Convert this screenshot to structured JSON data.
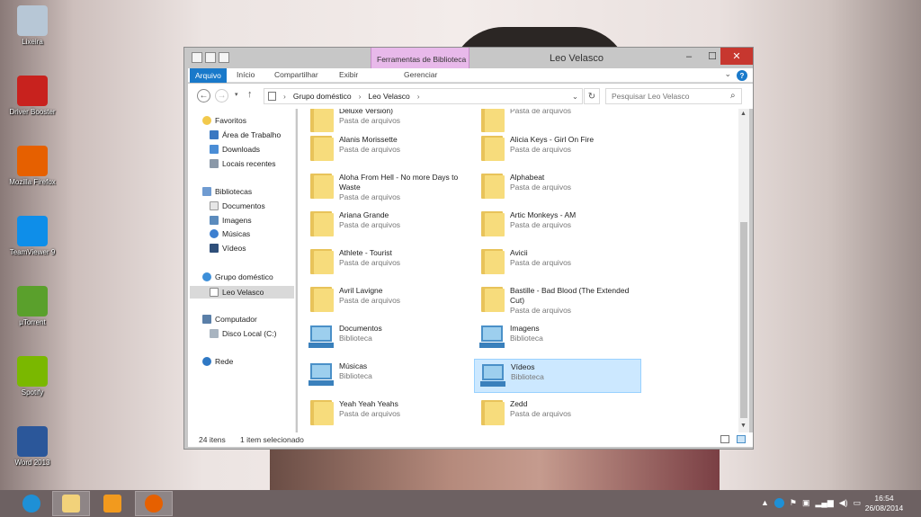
{
  "desktop": {
    "icons": [
      {
        "label": "Lixeira",
        "icon": "recycle-bin-icon",
        "color": "#b7c7d6"
      },
      {
        "label": "Driver Booster",
        "icon": "driver-booster-icon",
        "color": "#c8221e"
      },
      {
        "label": "Mozilla Firefox",
        "icon": "firefox-icon",
        "color": "#e66000"
      },
      {
        "label": "TeamViewer 9",
        "icon": "teamviewer-icon",
        "color": "#0e8ee9"
      },
      {
        "label": "µTorrent",
        "icon": "utorrent-icon",
        "color": "#5aa02c"
      },
      {
        "label": "Spotify",
        "icon": "spotify-icon",
        "color": "#7ab800"
      },
      {
        "label": "Word 2013",
        "icon": "word-icon",
        "color": "#2b579a"
      }
    ]
  },
  "window": {
    "title": "Leo Velasco",
    "context_tab_group": "Ferramentas de Biblioteca",
    "ribbon_tabs": [
      "Arquivo",
      "Início",
      "Compartilhar",
      "Exibir",
      "Gerenciar"
    ],
    "address": {
      "segments": [
        "Grupo doméstico",
        "Leo Velasco"
      ],
      "search_placeholder": "Pesquisar Leo Velasco"
    },
    "nav_pane": {
      "favorites": {
        "label": "Favoritos",
        "items": [
          "Área de Trabalho",
          "Downloads",
          "Locais recentes"
        ]
      },
      "libraries": {
        "label": "Bibliotecas",
        "items": [
          "Documentos",
          "Imagens",
          "Músicas",
          "Vídeos"
        ]
      },
      "homegroup": {
        "label": "Grupo doméstico",
        "items": [
          "Leo Velasco"
        ]
      },
      "computer": {
        "label": "Computador",
        "items": [
          "Disco Local (C:)"
        ]
      },
      "network": {
        "label": "Rede"
      }
    },
    "items": [
      {
        "name": "Deluxe Version)",
        "type": "Pasta de arquivos",
        "kind": "folder"
      },
      {
        "name": "",
        "type": "Pasta de arquivos",
        "kind": "folder"
      },
      {
        "name": "Alanis Morissette",
        "type": "Pasta de arquivos",
        "kind": "folder"
      },
      {
        "name": "Alicia Keys - Girl On Fire",
        "type": "Pasta de arquivos",
        "kind": "folder"
      },
      {
        "name": "Aloha From Hell - No more Days to Waste",
        "type": "Pasta de arquivos",
        "kind": "folder"
      },
      {
        "name": "Alphabeat",
        "type": "Pasta de arquivos",
        "kind": "folder"
      },
      {
        "name": "Ariana Grande",
        "type": "Pasta de arquivos",
        "kind": "folder"
      },
      {
        "name": "Artic Monkeys -  AM",
        "type": "Pasta de arquivos",
        "kind": "folder"
      },
      {
        "name": "Athlete - Tourist",
        "type": "Pasta de arquivos",
        "kind": "folder"
      },
      {
        "name": "Avicii",
        "type": "Pasta de arquivos",
        "kind": "folder"
      },
      {
        "name": "Avril Lavigne",
        "type": "Pasta de arquivos",
        "kind": "folder"
      },
      {
        "name": "Bastille - Bad Blood (The Extended Cut)",
        "type": "Pasta de arquivos",
        "kind": "folder"
      },
      {
        "name": "Documentos",
        "type": "Biblioteca",
        "kind": "library"
      },
      {
        "name": "Imagens",
        "type": "Biblioteca",
        "kind": "library"
      },
      {
        "name": "Músicas",
        "type": "Biblioteca",
        "kind": "library"
      },
      {
        "name": "Vídeos",
        "type": "Biblioteca",
        "kind": "library"
      },
      {
        "name": "Yeah Yeah Yeahs",
        "type": "Pasta de arquivos",
        "kind": "folder"
      },
      {
        "name": "Zedd",
        "type": "Pasta de arquivos",
        "kind": "folder"
      }
    ],
    "status": {
      "count": "24 itens",
      "selection": "1 item selecionado"
    }
  },
  "taskbar": {
    "apps": [
      "internet-explorer-icon",
      "file-explorer-icon",
      "media-player-icon",
      "firefox-icon"
    ],
    "clock_time": "16:54",
    "clock_date": "26/08/2014"
  }
}
